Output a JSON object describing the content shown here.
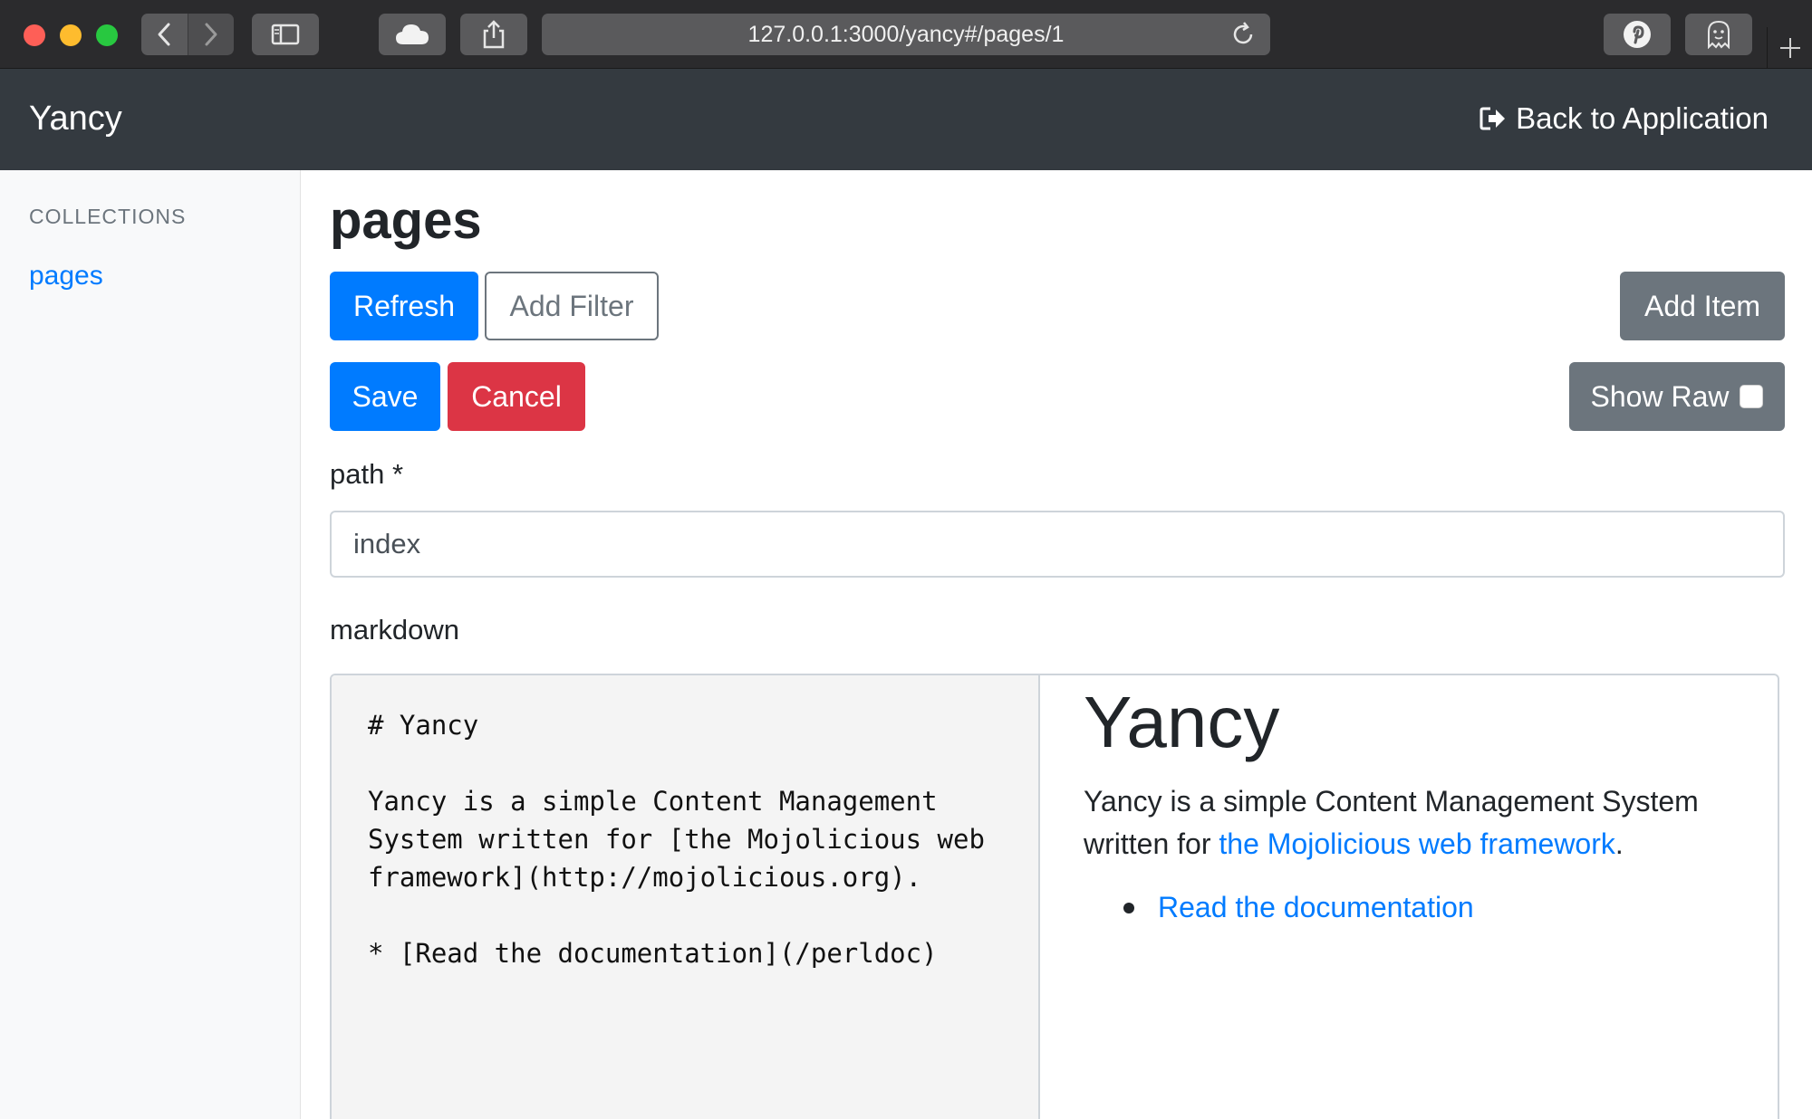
{
  "browser": {
    "url": "127.0.0.1:3000/yancy#/pages/1",
    "icons": [
      "chevron-left-icon",
      "chevron-right-icon",
      "sidebar-icon",
      "cloud-icon",
      "share-icon",
      "reload-icon",
      "pinterest-icon",
      "ghost-icon",
      "plus-icon"
    ]
  },
  "navbar": {
    "brand": "Yancy",
    "back_label": "Back to Application"
  },
  "sidebar": {
    "heading": "COLLECTIONS",
    "items": [
      {
        "label": "pages"
      }
    ]
  },
  "main": {
    "title": "pages",
    "refresh_label": "Refresh",
    "add_filter_label": "Add Filter",
    "add_item_label": "Add Item",
    "save_label": "Save",
    "cancel_label": "Cancel",
    "show_raw_label": "Show Raw",
    "show_raw_checked": false
  },
  "form": {
    "path_label": "path *",
    "path_value": "index",
    "markdown_label": "markdown",
    "markdown_source": [
      "# Yancy",
      "",
      "Yancy is a simple Content Management",
      "System written for [the Mojolicious web",
      "framework](http://mojolicious.org).",
      "",
      "* [Read the documentation](/perldoc)"
    ],
    "preview": {
      "heading": "Yancy",
      "para_before": "Yancy is a simple Content Management System written for ",
      "para_link": "the Mojolicious web framework",
      "para_after": ".",
      "list_item": "Read the documentation"
    }
  },
  "colors": {
    "primary": "#007bff",
    "danger": "#dc3545",
    "secondary": "#6c757d",
    "navbar": "#343a40"
  }
}
